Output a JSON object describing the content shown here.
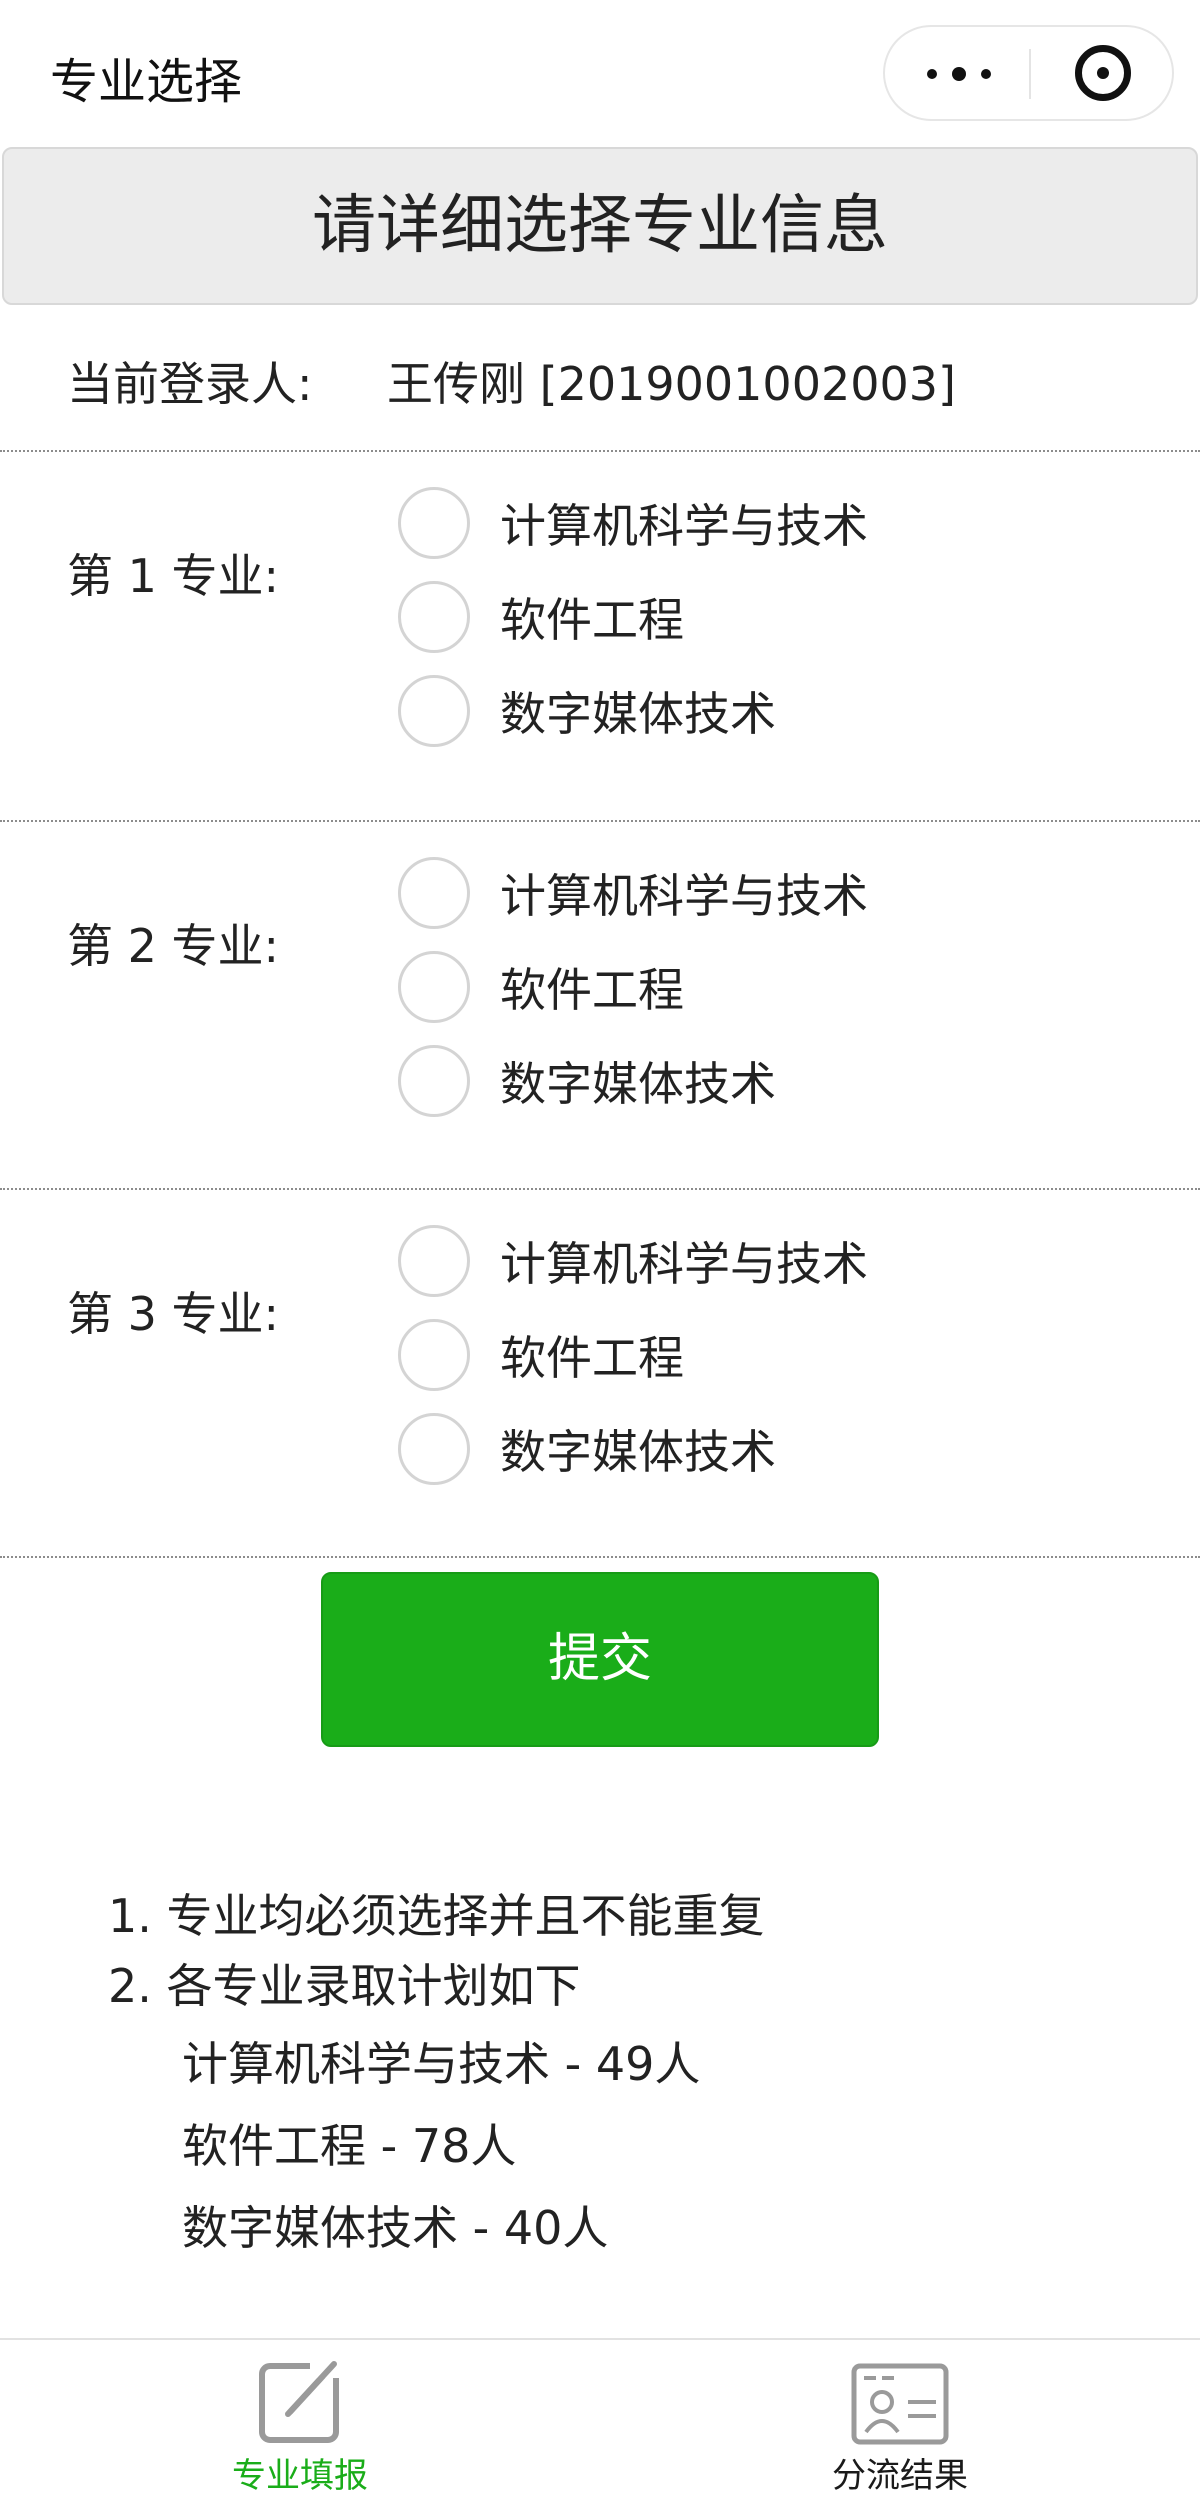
{
  "nav": {
    "title": "专业选择"
  },
  "banner": {
    "title": "请详细选择专业信息"
  },
  "login": {
    "label": "当前登录人:",
    "user": "王传刚 [2019001002003]"
  },
  "sections": [
    {
      "label": "第 1 专业:",
      "options": [
        "计算机科学与技术",
        "软件工程",
        "数字媒体技术"
      ]
    },
    {
      "label": "第 2 专业:",
      "options": [
        "计算机科学与技术",
        "软件工程",
        "数字媒体技术"
      ]
    },
    {
      "label": "第 3 专业:",
      "options": [
        "计算机科学与技术",
        "软件工程",
        "数字媒体技术"
      ]
    }
  ],
  "submit_label": "提交",
  "notes": {
    "line1": "1. 专业均必须选择并且不能重复",
    "line2": "2. 各专业录取计划如下",
    "quotas": [
      "计算机科学与技术 - 49人",
      "软件工程 - 78人",
      "数字媒体技术 - 40人"
    ]
  },
  "tabbar": {
    "items": [
      {
        "label": "专业填报",
        "icon": "edit-icon",
        "active": true
      },
      {
        "label": "分流结果",
        "icon": "id-card-icon",
        "active": false
      }
    ],
    "active_color": "#1aad19",
    "inactive_color": "#1a1a1a"
  },
  "colors": {
    "primary_button": "#1aad19",
    "banner_bg": "#ececec"
  }
}
